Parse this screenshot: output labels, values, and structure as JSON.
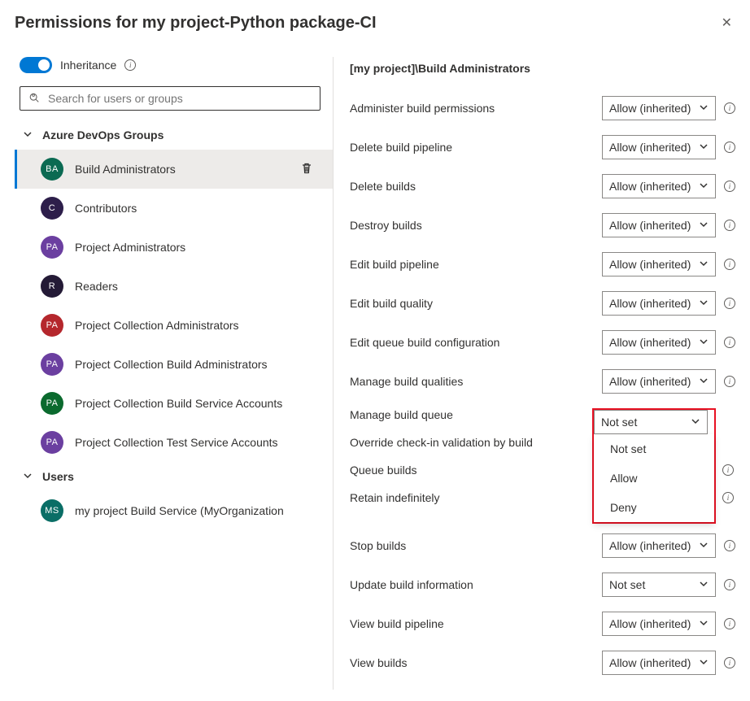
{
  "header": {
    "title": "Permissions for my project-Python package-CI"
  },
  "inheritance": {
    "label": "Inheritance"
  },
  "search": {
    "placeholder": "Search for users or groups"
  },
  "sections": {
    "groupsLabel": "Azure DevOps Groups",
    "usersLabel": "Users"
  },
  "groups": [
    {
      "initials": "BA",
      "name": "Build Administrators",
      "color": "#0b6a52",
      "selected": true
    },
    {
      "initials": "C",
      "name": "Contributors",
      "color": "#2d1e4a"
    },
    {
      "initials": "PA",
      "name": "Project Administrators",
      "color": "#6b3fa0"
    },
    {
      "initials": "R",
      "name": "Readers",
      "color": "#241a36"
    },
    {
      "initials": "PA",
      "name": "Project Collection Administrators",
      "color": "#b5272d"
    },
    {
      "initials": "PA",
      "name": "Project Collection Build Administrators",
      "color": "#6b3fa0"
    },
    {
      "initials": "PA",
      "name": "Project Collection Build Service Accounts",
      "color": "#0b6a2e"
    },
    {
      "initials": "PA",
      "name": "Project Collection Test Service Accounts",
      "color": "#6b3fa0"
    }
  ],
  "users": [
    {
      "initials": "MS",
      "name": "my project Build Service (MyOrganization",
      "color": "#0a6e66"
    }
  ],
  "rightTitle": "[my project]\\Build Administrators",
  "perms": [
    {
      "label": "Administer build permissions",
      "value": "Allow (inherited)",
      "info": true
    },
    {
      "label": "Delete build pipeline",
      "value": "Allow (inherited)",
      "info": true
    },
    {
      "label": "Delete builds",
      "value": "Allow (inherited)",
      "info": true
    },
    {
      "label": "Destroy builds",
      "value": "Allow (inherited)",
      "info": true
    },
    {
      "label": "Edit build pipeline",
      "value": "Allow (inherited)",
      "info": true
    },
    {
      "label": "Edit build quality",
      "value": "Allow (inherited)",
      "info": true
    },
    {
      "label": "Edit queue build configuration",
      "value": "Allow (inherited)",
      "info": true
    },
    {
      "label": "Manage build qualities",
      "value": "Allow (inherited)",
      "info": true
    }
  ],
  "openPerm": {
    "label": "Manage build queue",
    "value": "Not set",
    "options": [
      "Not set",
      "Allow",
      "Deny"
    ]
  },
  "midPerms": [
    {
      "label": "Override check-in validation by build"
    },
    {
      "label": "Queue builds",
      "info": true
    },
    {
      "label": "Retain indefinitely",
      "info": true
    }
  ],
  "perms2": [
    {
      "label": "Stop builds",
      "value": "Allow (inherited)",
      "info": true
    },
    {
      "label": "Update build information",
      "value": "Not set",
      "info": true
    },
    {
      "label": "View build pipeline",
      "value": "Allow (inherited)",
      "info": true
    },
    {
      "label": "View builds",
      "value": "Allow (inherited)",
      "info": true
    }
  ]
}
